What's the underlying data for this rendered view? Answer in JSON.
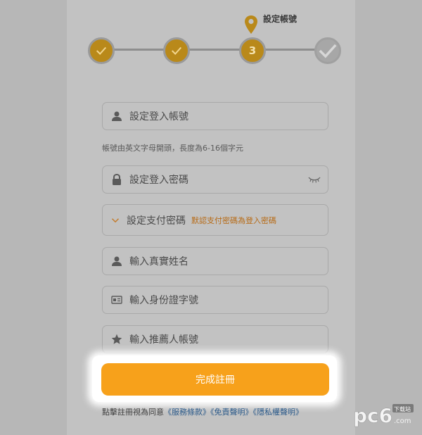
{
  "stepper": {
    "current_label": "設定帳號",
    "current_number": "3",
    "colors": {
      "done": "#b9891a",
      "todo": "#a7a7a7"
    }
  },
  "form": {
    "account_placeholder": "設定登入帳號",
    "account_hint": "帳號由英文字母開頭，長度為6-16個字元",
    "password_placeholder": "設定登入密碼",
    "payment_password_label": "設定支付密碼",
    "payment_password_note": "默認支付密碼為登入密碼",
    "real_name_placeholder": "輸入真實姓名",
    "id_number_placeholder": "輸入身份證字號",
    "referrer_placeholder": "輸入推薦人帳號"
  },
  "submit_label": "完成註冊",
  "terms": {
    "prefix": "點擊註冊視為同意",
    "link1": "《服務條款》",
    "link2": "《免責聲明》",
    "link3": "《隱私權聲明》"
  },
  "watermark": {
    "brand": "pc6",
    "badge": "下载站",
    "site": ".com"
  },
  "accent_color": "#f7a11b"
}
